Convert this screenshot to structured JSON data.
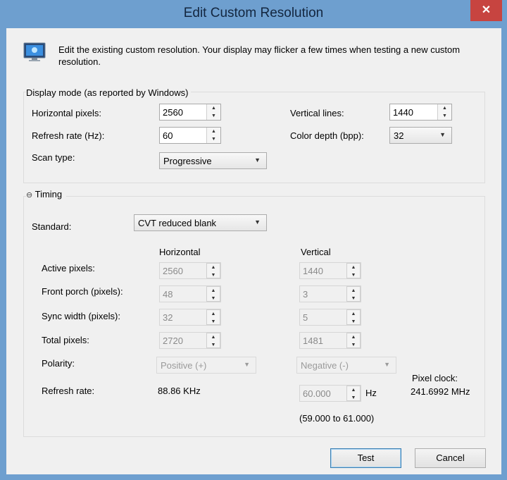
{
  "window": {
    "title": "Edit Custom Resolution",
    "close_glyph": "✕"
  },
  "description": "Edit the existing custom resolution. Your display may flicker a few times when testing a new custom resolution.",
  "display_mode": {
    "heading": "Display mode (as reported by Windows)",
    "horizontal_pixels": {
      "label": "Horizontal pixels:",
      "value": "2560"
    },
    "vertical_lines": {
      "label": "Vertical lines:",
      "value": "1440"
    },
    "refresh_rate": {
      "label": "Refresh rate (Hz):",
      "value": "60"
    },
    "color_depth": {
      "label": "Color depth (bpp):",
      "value": "32"
    },
    "scan_type": {
      "label": "Scan type:",
      "value": "Progressive"
    }
  },
  "timing": {
    "heading": "Timing",
    "toggle_glyph": "⊖",
    "standard": {
      "label": "Standard:",
      "value": "CVT reduced blank"
    },
    "col_horizontal": "Horizontal",
    "col_vertical": "Vertical",
    "rows": [
      {
        "label": "Active pixels:",
        "h": "2560",
        "v": "1440"
      },
      {
        "label": "Front porch (pixels):",
        "h": "48",
        "v": "3"
      },
      {
        "label": "Sync width (pixels):",
        "h": "32",
        "v": "5"
      },
      {
        "label": "Total pixels:",
        "h": "2720",
        "v": "1481"
      }
    ],
    "polarity": {
      "label": "Polarity:",
      "h": "Positive (+)",
      "v": "Negative (-)"
    },
    "refresh": {
      "label": "Refresh rate:",
      "h": "88.86 KHz",
      "v": "60.000",
      "unit": "Hz",
      "range": "(59.000 to 61.000)"
    },
    "pixel_clock": {
      "label": "Pixel clock:",
      "value": "241.6992 MHz"
    }
  },
  "buttons": {
    "test": "Test",
    "cancel": "Cancel"
  },
  "icons": {
    "monitor": "monitor-icon",
    "close": "close-icon",
    "collapse": "collapse-icon",
    "spin": "spin-arrows-icon",
    "dropdown": "chevron-down-icon"
  },
  "colors": {
    "titlebar": "#6e9fcf",
    "close": "#c74440",
    "dialog_bg": "#f0f0f0"
  }
}
